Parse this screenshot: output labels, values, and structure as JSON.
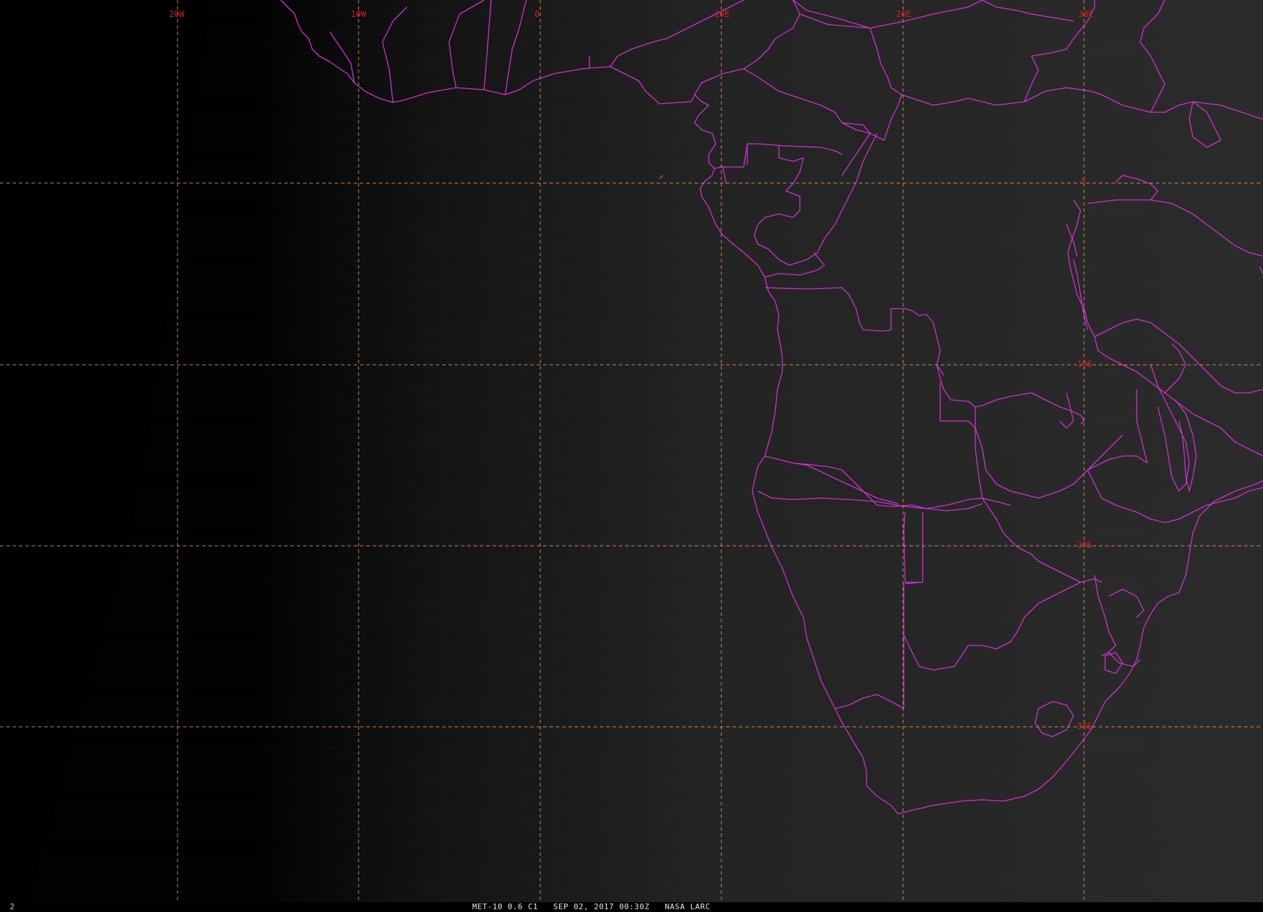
{
  "image": {
    "frame_number": "2",
    "caption": "MET-10 0.6 C1   SEP 02, 2017 00:30Z   NASA LARC"
  },
  "colors": {
    "background_dark": "#000000",
    "background_lit": "#2a2a2a",
    "gridline": "#d89a5c",
    "grid_label": "#d12020",
    "border": "#d230d2",
    "frame_number": "#ffd800"
  },
  "grid": {
    "longitude_labels": [
      "20W",
      "10W",
      "0",
      "10E",
      "20E",
      "30E"
    ],
    "latitude_labels": [
      "0",
      "10S",
      "20S",
      "30S"
    ]
  }
}
